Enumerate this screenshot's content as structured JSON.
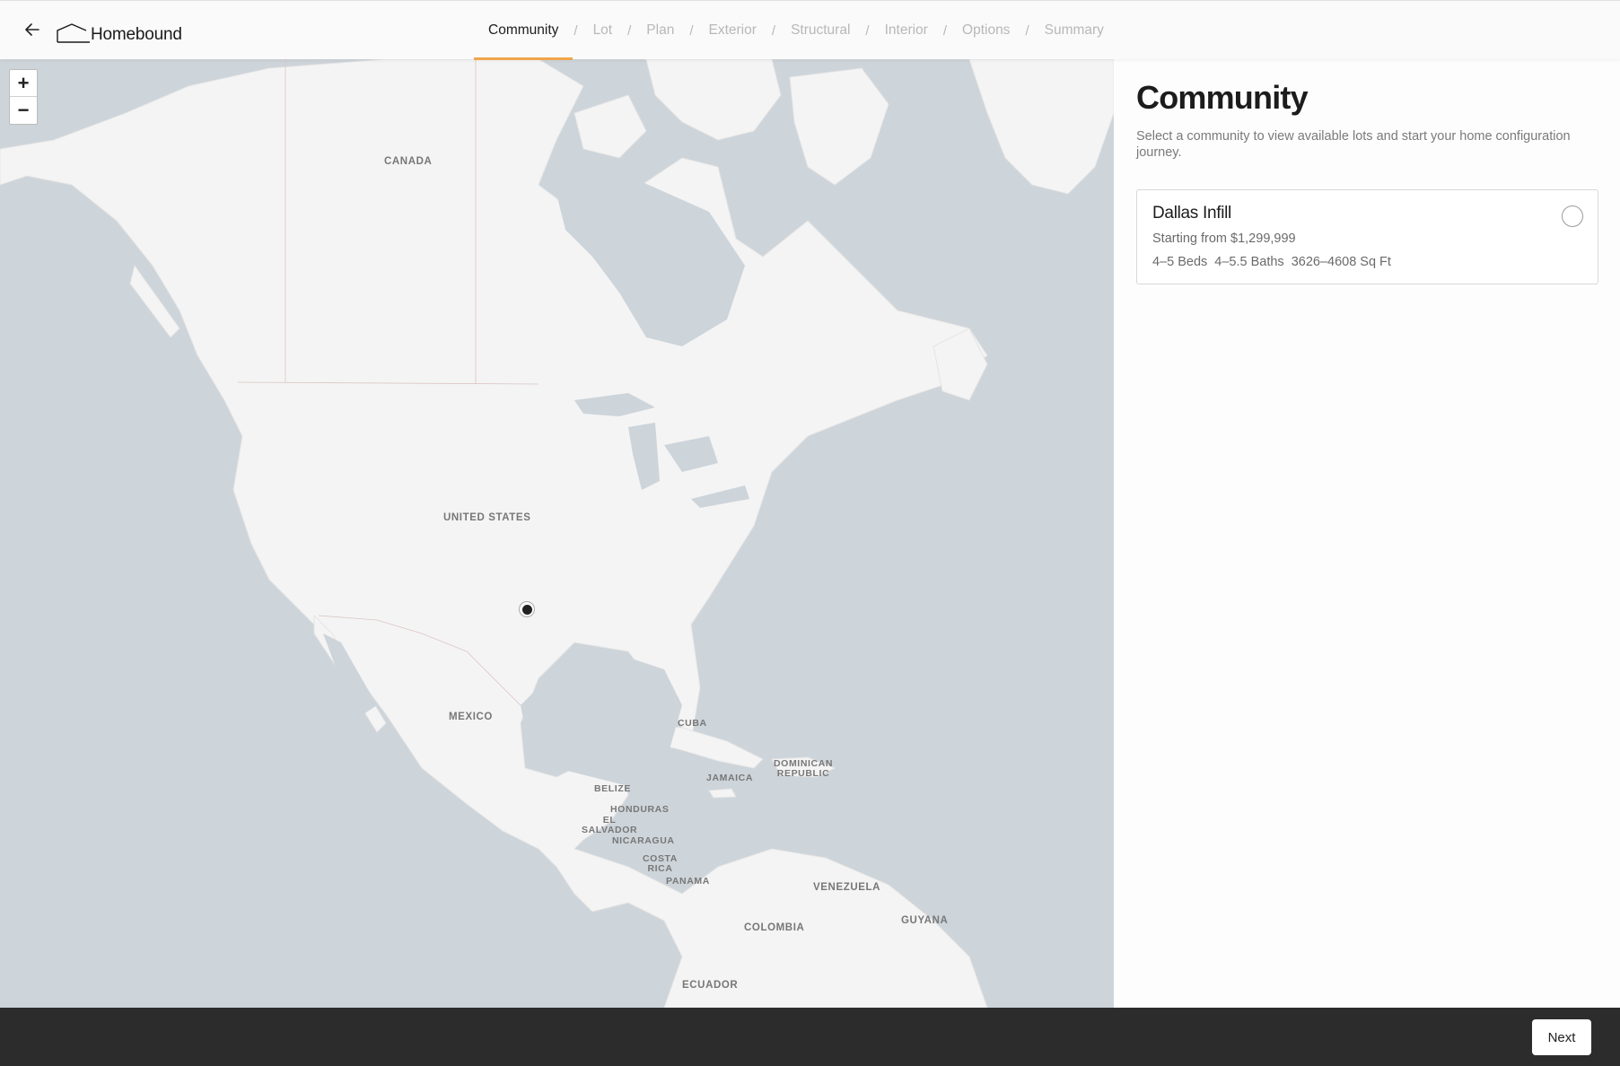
{
  "header": {
    "logo_text": "Homebound",
    "steps": [
      {
        "label": "Community"
      },
      {
        "label": "Lot"
      },
      {
        "label": "Plan"
      },
      {
        "label": "Exterior"
      },
      {
        "label": "Structural"
      },
      {
        "label": "Interior"
      },
      {
        "label": "Options"
      },
      {
        "label": "Summary"
      }
    ],
    "separator": "/",
    "active_step": "Community"
  },
  "map": {
    "zoom_in": "+",
    "zoom_out": "−",
    "labels": {
      "canada": "CANADA",
      "united_states": "UNITED STATES",
      "mexico": "MEXICO",
      "cuba": "CUBA",
      "jamaica": "JAMAICA",
      "dominican_republic": "DOMINICAN\nREPUBLIC",
      "belize": "BELIZE",
      "honduras": "HONDURAS",
      "el_salvador": "EL\nSALVADOR",
      "nicaragua": "NICARAGUA",
      "costa_rica": "COSTA\nRICA",
      "panama": "PANAMA",
      "venezuela": "VENEZUELA",
      "guyana": "GUYANA",
      "colombia": "COLOMBIA",
      "ecuador": "ECUADOR"
    }
  },
  "panel": {
    "title": "Community",
    "description": "Select a community to view available lots and start your home configuration journey.",
    "communities": [
      {
        "name": "Dallas Infill",
        "price": "Starting from $1,299,999",
        "beds": "4–5 Beds",
        "baths": "4–5.5 Baths",
        "sqft": "3626–4608 Sq Ft"
      }
    ]
  },
  "footer": {
    "next_label": "Next"
  },
  "colors": {
    "accent": "#f0a54b",
    "water": "#cdd4da",
    "land": "#f4f4f4",
    "footer": "#2c2c2c"
  }
}
